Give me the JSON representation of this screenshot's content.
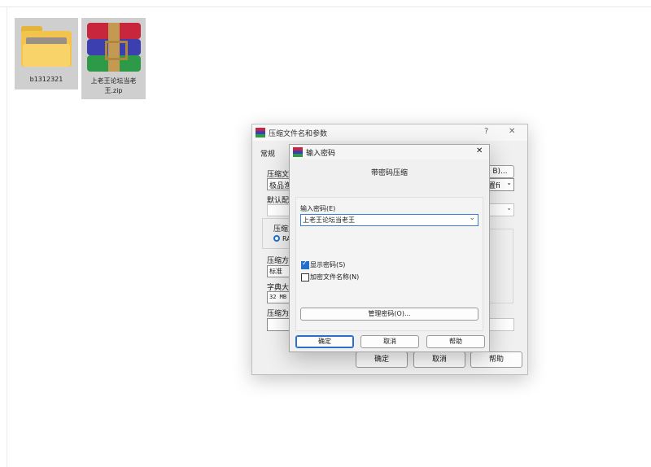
{
  "desktop": {
    "items": [
      {
        "name": "b1312321"
      },
      {
        "name_line1": "上老王论坛当老",
        "name_line2": "王.zip"
      }
    ]
  },
  "archive_window": {
    "title": "压缩文件名和参数",
    "help_glyph": "?",
    "close_glyph": "✕",
    "tab_general": "常规",
    "label_archive_name": "压缩文",
    "archive_name_value": "极品渔",
    "browse_fragment": "B)...",
    "profile_fragment": "置fi",
    "label_default": "默认配",
    "label_format": "压缩文",
    "format_rar": "RA",
    "label_method": "压缩方",
    "method_value": "标准",
    "label_dict": "字典大",
    "dict_value": "32 MB",
    "label_split": "压缩为",
    "ok": "确定",
    "cancel": "取消",
    "help": "帮助"
  },
  "password_dialog": {
    "title": "输入密码",
    "close_glyph": "✕",
    "heading": "带密码压缩",
    "label_password": "输入密码(E)",
    "password_value": "上老王论坛当老王",
    "show_password": "显示密码(S)",
    "encrypt_names": "加密文件名称(N)",
    "manage_passwords": "管理密码(O)...",
    "ok": "确定",
    "cancel": "取消",
    "help": "帮助",
    "show_password_checked": true,
    "encrypt_names_checked": false
  }
}
